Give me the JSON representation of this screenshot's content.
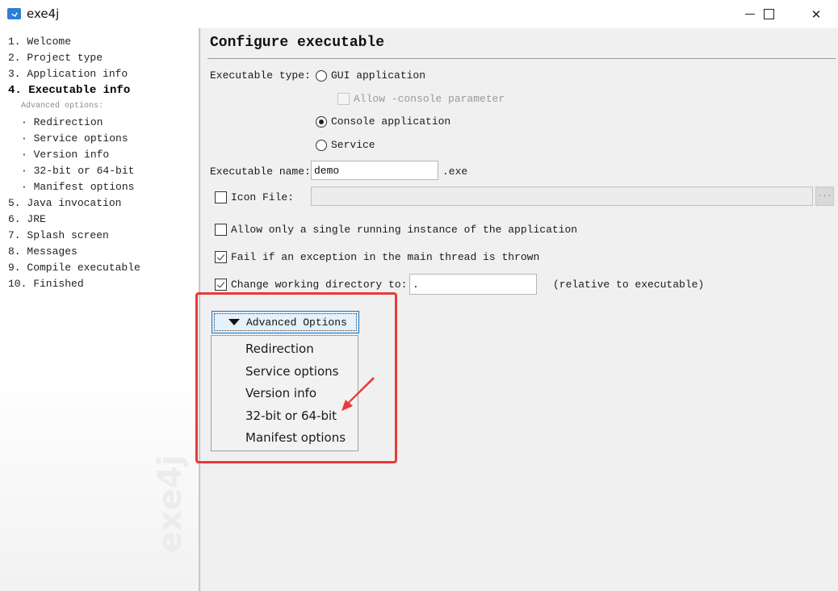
{
  "window": {
    "title": "exe4j",
    "controls": {
      "minimize": "minimize-icon",
      "maximize": "maximize-icon",
      "close": "close-icon"
    }
  },
  "sidebar": {
    "watermark": "exe4j",
    "items": [
      {
        "label": "1. Welcome"
      },
      {
        "label": "2. Project type"
      },
      {
        "label": "3. Application info"
      },
      {
        "label": "4. Executable info",
        "active": true
      }
    ],
    "advanced_heading": "Advanced options:",
    "advanced_items": [
      {
        "label": "· Redirection"
      },
      {
        "label": "· Service options"
      },
      {
        "label": "· Version info"
      },
      {
        "label": "· 32-bit or 64-bit"
      },
      {
        "label": "· Manifest options"
      }
    ],
    "items_after": [
      {
        "label": "5. Java invocation"
      },
      {
        "label": "6. JRE"
      },
      {
        "label": "7. Splash screen"
      },
      {
        "label": "8. Messages"
      },
      {
        "label": "9. Compile executable"
      },
      {
        "label": "10. Finished"
      }
    ]
  },
  "main": {
    "title": "Configure executable",
    "executable_type": {
      "label": "Executable type:",
      "options": [
        {
          "label": "GUI application",
          "selected": false
        },
        {
          "label": "Console application",
          "selected": true
        },
        {
          "label": "Service",
          "selected": false
        }
      ],
      "allow_console_param": {
        "label": "Allow -console parameter",
        "checked": false,
        "disabled": true
      }
    },
    "executable_name": {
      "label": "Executable name:",
      "value": "demo",
      "suffix": ".exe"
    },
    "icon_file": {
      "label": "Icon File:",
      "checked": false,
      "value": "",
      "browse_label": "..."
    },
    "single_instance": {
      "label": "Allow only a single running instance of the application",
      "checked": false
    },
    "fail_on_exception": {
      "label": "Fail if an exception in the main thread is thrown",
      "checked": true
    },
    "change_working_dir": {
      "label": "Change working directory to:",
      "checked": true,
      "value": ".",
      "hint": "(relative to executable)"
    },
    "advanced_button": {
      "label": "Advanced Options"
    },
    "advanced_menu": [
      {
        "label": "Redirection"
      },
      {
        "label": "Service options"
      },
      {
        "label": "Version info"
      },
      {
        "label": "32-bit or 64-bit",
        "annotated": true
      },
      {
        "label": "Manifest options"
      }
    ]
  },
  "annotation": {
    "color": "#e83a3a"
  }
}
